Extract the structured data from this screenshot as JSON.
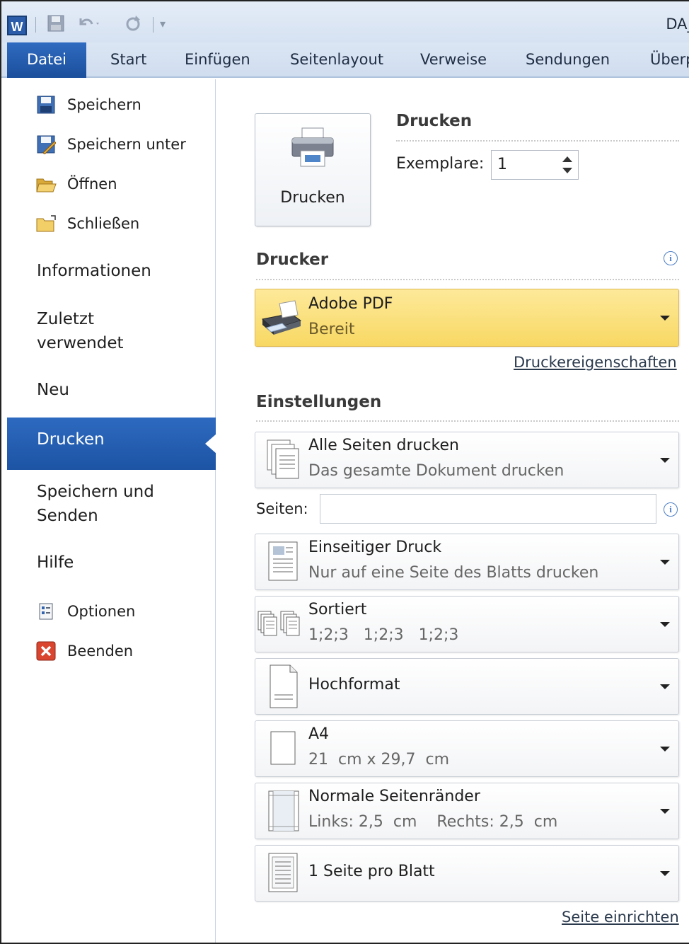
{
  "window": {
    "title": "DA_",
    "app_logo": "W"
  },
  "ribbon": {
    "tabs": [
      {
        "label": "Datei"
      },
      {
        "label": "Start"
      },
      {
        "label": "Einfügen"
      },
      {
        "label": "Seitenlayout"
      },
      {
        "label": "Verweise"
      },
      {
        "label": "Sendungen"
      },
      {
        "label": "Überp"
      }
    ]
  },
  "nav": {
    "commands": [
      {
        "label": "Speichern",
        "icon": "save-icon"
      },
      {
        "label": "Speichern unter",
        "icon": "save-as-icon"
      },
      {
        "label": "Öffnen",
        "icon": "open-folder-icon"
      },
      {
        "label": "Schließen",
        "icon": "close-folder-icon"
      }
    ],
    "tabs": {
      "informationen": "Informationen",
      "zuletzt": "Zuletzt verwendet",
      "neu": "Neu",
      "drucken": "Drucken",
      "speichern_senden": "Speichern und Senden",
      "hilfe": "Hilfe"
    },
    "bottom": [
      {
        "label": "Optionen",
        "icon": "options-icon"
      },
      {
        "label": "Beenden",
        "icon": "exit-icon"
      }
    ]
  },
  "print": {
    "heading": "Drucken",
    "button_label": "Drucken",
    "copies_label": "Exemplare:",
    "copies_value": "1"
  },
  "printer": {
    "heading": "Drucker",
    "name": "Adobe PDF",
    "status": "Bereit",
    "properties_link": "Druckereigenschaften"
  },
  "settings": {
    "heading": "Einstellungen",
    "pages_label": "Seiten:",
    "pages_value": "",
    "items": [
      {
        "title": "Alle Seiten drucken",
        "subtitle": "Das gesamte Dokument drucken"
      },
      {
        "title": "Einseitiger Druck",
        "subtitle": "Nur auf eine Seite des Blatts drucken"
      },
      {
        "title": "Sortiert",
        "subtitle": "1;2;3   1;2;3   1;2;3"
      },
      {
        "title": "Hochformat",
        "subtitle": ""
      },
      {
        "title": "A4",
        "subtitle": "21  cm x 29,7  cm"
      },
      {
        "title": "Normale Seitenränder",
        "subtitle": "Links: 2,5  cm    Rechts: 2,5  cm"
      },
      {
        "title": "1 Seite pro Blatt",
        "subtitle": ""
      }
    ],
    "page_setup_link": "Seite einrichten"
  },
  "colors": {
    "accent": "#1d54a4",
    "printer_highlight": "#f8d863"
  }
}
